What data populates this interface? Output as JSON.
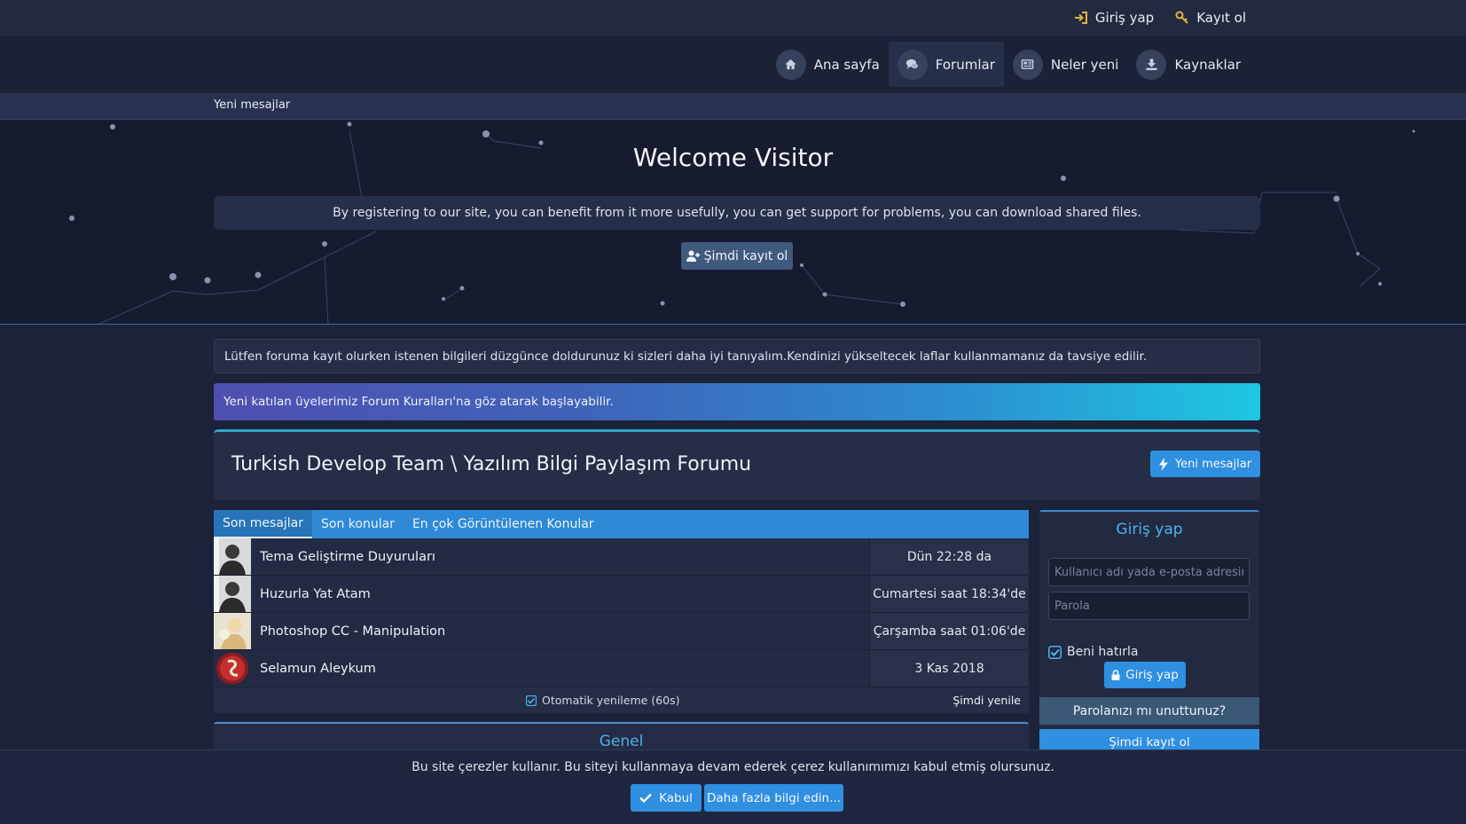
{
  "topbar": {
    "login": "Giriş yap",
    "register": "Kayıt ol"
  },
  "nav": [
    {
      "label": "Ana sayfa",
      "icon": "home-icon"
    },
    {
      "label": "Forumlar",
      "icon": "chat-icon"
    },
    {
      "label": "Neler yeni",
      "icon": "newspaper-icon"
    },
    {
      "label": "Kaynaklar",
      "icon": "download-icon"
    }
  ],
  "subnav": {
    "new_posts": "Yeni mesajlar"
  },
  "hero": {
    "title": "Welcome Visitor",
    "message": "By registering to our site, you can benefit from it more usefully, you can get support for problems, you can download shared files.",
    "register_button": "Şimdi kayıt ol"
  },
  "notices": [
    "Lütfen foruma kayıt olurken istenen bilgileri düzgünce doldurunuz ki sizleri daha iyi tanıyalım.Kendinizi yükseltecek laflar kullanmamanız da tavsiye edilir.",
    "Yeni katılan üyelerimiz Forum Kuralları'na göz atarak başlayabilir."
  ],
  "forum": {
    "title": "Turkish Develop Team \\ Yazılım Bilgi Paylaşım Forumu",
    "new_posts_button": "Yeni mesajlar"
  },
  "latest": {
    "tabs": [
      "Son mesajlar",
      "Son konular",
      "En çok Görüntülenen Konular"
    ],
    "rows": [
      {
        "title": "Tema Geliştirme Duyuruları",
        "date": "Dün 22:28 da"
      },
      {
        "title": "Huzurla Yat Atam",
        "date": "Cumartesi saat 18:34'de"
      },
      {
        "title": "Photoshop CC - Manipulation",
        "date": "Çarşamba saat 01:06'de"
      },
      {
        "title": "Selamun Aleykum",
        "date": "3 Kas 2018"
      }
    ],
    "auto_refresh": "Otomatik yenileme (60s)",
    "refresh_now": "Şimdi yenile"
  },
  "section": {
    "title": "Genel"
  },
  "login": {
    "title": "Giriş yap",
    "username_placeholder": "Kullanıcı adı yada e-posta adresiniz",
    "password_placeholder": "Parola",
    "remember": "Beni hatırla",
    "submit": "Giriş yap",
    "forgot": "Parolanızı mı unuttunuz?",
    "register": "Şimdi kayıt ol"
  },
  "cookie": {
    "text": "Bu site çerezler kullanır. Bu siteyi kullanmaya devam ederek çerez kullanımımızı kabul etmiş olursunuz.",
    "accept": "Kabul",
    "more": "Daha fazla bilgi edin..."
  },
  "colors": {
    "accent": "#2f8fe0",
    "link_blue": "#4fb3ea",
    "icon_gold": "#e3b43c"
  }
}
